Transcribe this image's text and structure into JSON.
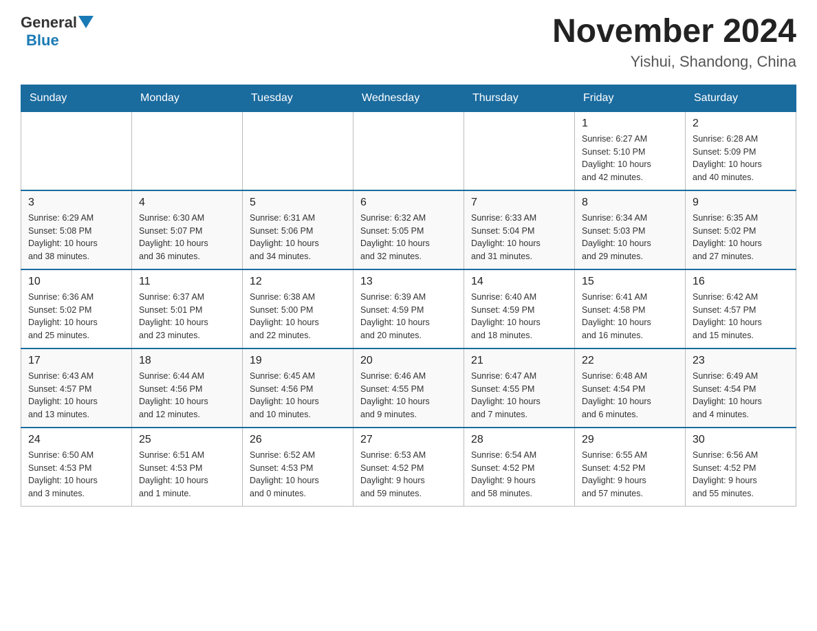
{
  "header": {
    "logo": {
      "general": "General",
      "blue": "Blue"
    },
    "title": "November 2024",
    "location": "Yishui, Shandong, China"
  },
  "weekdays": [
    "Sunday",
    "Monday",
    "Tuesday",
    "Wednesday",
    "Thursday",
    "Friday",
    "Saturday"
  ],
  "weeks": [
    [
      {
        "day": "",
        "info": ""
      },
      {
        "day": "",
        "info": ""
      },
      {
        "day": "",
        "info": ""
      },
      {
        "day": "",
        "info": ""
      },
      {
        "day": "",
        "info": ""
      },
      {
        "day": "1",
        "info": "Sunrise: 6:27 AM\nSunset: 5:10 PM\nDaylight: 10 hours\nand 42 minutes."
      },
      {
        "day": "2",
        "info": "Sunrise: 6:28 AM\nSunset: 5:09 PM\nDaylight: 10 hours\nand 40 minutes."
      }
    ],
    [
      {
        "day": "3",
        "info": "Sunrise: 6:29 AM\nSunset: 5:08 PM\nDaylight: 10 hours\nand 38 minutes."
      },
      {
        "day": "4",
        "info": "Sunrise: 6:30 AM\nSunset: 5:07 PM\nDaylight: 10 hours\nand 36 minutes."
      },
      {
        "day": "5",
        "info": "Sunrise: 6:31 AM\nSunset: 5:06 PM\nDaylight: 10 hours\nand 34 minutes."
      },
      {
        "day": "6",
        "info": "Sunrise: 6:32 AM\nSunset: 5:05 PM\nDaylight: 10 hours\nand 32 minutes."
      },
      {
        "day": "7",
        "info": "Sunrise: 6:33 AM\nSunset: 5:04 PM\nDaylight: 10 hours\nand 31 minutes."
      },
      {
        "day": "8",
        "info": "Sunrise: 6:34 AM\nSunset: 5:03 PM\nDaylight: 10 hours\nand 29 minutes."
      },
      {
        "day": "9",
        "info": "Sunrise: 6:35 AM\nSunset: 5:02 PM\nDaylight: 10 hours\nand 27 minutes."
      }
    ],
    [
      {
        "day": "10",
        "info": "Sunrise: 6:36 AM\nSunset: 5:02 PM\nDaylight: 10 hours\nand 25 minutes."
      },
      {
        "day": "11",
        "info": "Sunrise: 6:37 AM\nSunset: 5:01 PM\nDaylight: 10 hours\nand 23 minutes."
      },
      {
        "day": "12",
        "info": "Sunrise: 6:38 AM\nSunset: 5:00 PM\nDaylight: 10 hours\nand 22 minutes."
      },
      {
        "day": "13",
        "info": "Sunrise: 6:39 AM\nSunset: 4:59 PM\nDaylight: 10 hours\nand 20 minutes."
      },
      {
        "day": "14",
        "info": "Sunrise: 6:40 AM\nSunset: 4:59 PM\nDaylight: 10 hours\nand 18 minutes."
      },
      {
        "day": "15",
        "info": "Sunrise: 6:41 AM\nSunset: 4:58 PM\nDaylight: 10 hours\nand 16 minutes."
      },
      {
        "day": "16",
        "info": "Sunrise: 6:42 AM\nSunset: 4:57 PM\nDaylight: 10 hours\nand 15 minutes."
      }
    ],
    [
      {
        "day": "17",
        "info": "Sunrise: 6:43 AM\nSunset: 4:57 PM\nDaylight: 10 hours\nand 13 minutes."
      },
      {
        "day": "18",
        "info": "Sunrise: 6:44 AM\nSunset: 4:56 PM\nDaylight: 10 hours\nand 12 minutes."
      },
      {
        "day": "19",
        "info": "Sunrise: 6:45 AM\nSunset: 4:56 PM\nDaylight: 10 hours\nand 10 minutes."
      },
      {
        "day": "20",
        "info": "Sunrise: 6:46 AM\nSunset: 4:55 PM\nDaylight: 10 hours\nand 9 minutes."
      },
      {
        "day": "21",
        "info": "Sunrise: 6:47 AM\nSunset: 4:55 PM\nDaylight: 10 hours\nand 7 minutes."
      },
      {
        "day": "22",
        "info": "Sunrise: 6:48 AM\nSunset: 4:54 PM\nDaylight: 10 hours\nand 6 minutes."
      },
      {
        "day": "23",
        "info": "Sunrise: 6:49 AM\nSunset: 4:54 PM\nDaylight: 10 hours\nand 4 minutes."
      }
    ],
    [
      {
        "day": "24",
        "info": "Sunrise: 6:50 AM\nSunset: 4:53 PM\nDaylight: 10 hours\nand 3 minutes."
      },
      {
        "day": "25",
        "info": "Sunrise: 6:51 AM\nSunset: 4:53 PM\nDaylight: 10 hours\nand 1 minute."
      },
      {
        "day": "26",
        "info": "Sunrise: 6:52 AM\nSunset: 4:53 PM\nDaylight: 10 hours\nand 0 minutes."
      },
      {
        "day": "27",
        "info": "Sunrise: 6:53 AM\nSunset: 4:52 PM\nDaylight: 9 hours\nand 59 minutes."
      },
      {
        "day": "28",
        "info": "Sunrise: 6:54 AM\nSunset: 4:52 PM\nDaylight: 9 hours\nand 58 minutes."
      },
      {
        "day": "29",
        "info": "Sunrise: 6:55 AM\nSunset: 4:52 PM\nDaylight: 9 hours\nand 57 minutes."
      },
      {
        "day": "30",
        "info": "Sunrise: 6:56 AM\nSunset: 4:52 PM\nDaylight: 9 hours\nand 55 minutes."
      }
    ]
  ]
}
